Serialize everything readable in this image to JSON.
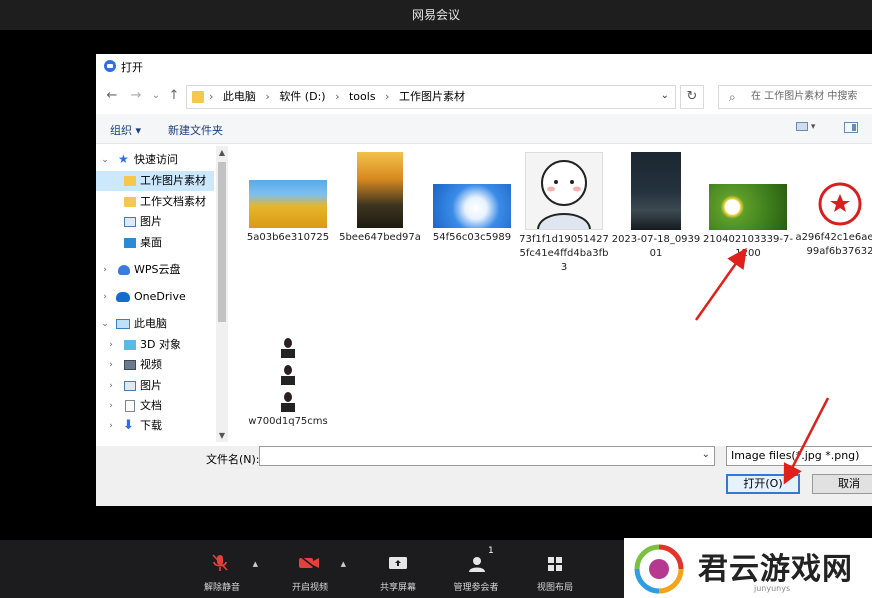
{
  "app": {
    "title": "网易会议"
  },
  "dialog": {
    "title": "打开",
    "nav": {
      "back": "←",
      "forward": "→",
      "history": "⌄",
      "up": "↑"
    },
    "address": {
      "crumbs": [
        "此电脑",
        "软件 (D:)",
        "tools",
        "工作图片素材"
      ],
      "separator": "›"
    },
    "search_placeholder": "在 工作图片素材 中搜索",
    "toolbar": {
      "organize": "组织 ▾",
      "new_folder": "新建文件夹"
    },
    "sidebar": [
      {
        "label": "快速访问",
        "icon": "star-icon",
        "selected": false
      },
      {
        "label": "工作图片素材",
        "icon": "folder-icon",
        "selected": true
      },
      {
        "label": "工作文档素材",
        "icon": "folder-icon",
        "selected": false
      },
      {
        "label": "图片",
        "icon": "pictures-icon",
        "selected": false
      },
      {
        "label": "桌面",
        "icon": "desktop-icon",
        "selected": false
      },
      {
        "label": "WPS云盘",
        "icon": "wps-cloud-icon",
        "selected": false
      },
      {
        "label": "OneDrive",
        "icon": "onedrive-icon",
        "selected": false
      },
      {
        "label": "此电脑",
        "icon": "computer-icon",
        "selected": false
      },
      {
        "label": "3D 对象",
        "icon": "3d-objects-icon",
        "selected": false
      },
      {
        "label": "视频",
        "icon": "video-icon",
        "selected": false
      },
      {
        "label": "图片",
        "icon": "pictures-icon",
        "selected": false
      },
      {
        "label": "文档",
        "icon": "documents-icon",
        "selected": false
      },
      {
        "label": "下载",
        "icon": "download-icon",
        "selected": false
      }
    ],
    "files": [
      {
        "name": "5a03b6e310725",
        "thumb": "yellow-trees"
      },
      {
        "name": "5bee647bed97a",
        "thumb": "sunset-flowers"
      },
      {
        "name": "54f56c03c5989",
        "thumb": "heart-cloud"
      },
      {
        "name": "73f1f1d190514275fc41e4ffd4ba3fb3",
        "thumb": "cartoon-face"
      },
      {
        "name": "2023-07-18_093901",
        "thumb": "night-poster"
      },
      {
        "name": "210402103339-7-1200",
        "thumb": "daisy"
      },
      {
        "name": "a296f42c1e6aecc99af6b37632",
        "thumb": "red-stamp"
      },
      {
        "name": "w700d1q75cms",
        "thumb": "id-photos"
      }
    ],
    "footer": {
      "filename_label": "文件名(N):",
      "filename_value": "",
      "filetype": "Image files(*.jpg *.png)",
      "open": "打开(O)",
      "cancel": "取消"
    }
  },
  "meeting_toolbar": [
    {
      "label": "解除静音",
      "icon": "mic-muted-icon",
      "has_caret": true
    },
    {
      "label": "开启视频",
      "icon": "video-off-icon",
      "has_caret": true
    },
    {
      "label": "共享屏幕",
      "icon": "share-screen-icon",
      "has_caret": false
    },
    {
      "label": "管理参会者",
      "icon": "participants-icon",
      "badge": "1",
      "has_caret": false
    },
    {
      "label": "视图布局",
      "icon": "layout-icon",
      "has_caret": false
    }
  ],
  "watermark": {
    "text": "君云游戏网",
    "url": "junyunys"
  },
  "colors": {
    "accent": "#3677d4",
    "arrow": "#e0201b",
    "selected_bg": "#cce8ff",
    "meeting_icon_red": "#e5413b"
  }
}
